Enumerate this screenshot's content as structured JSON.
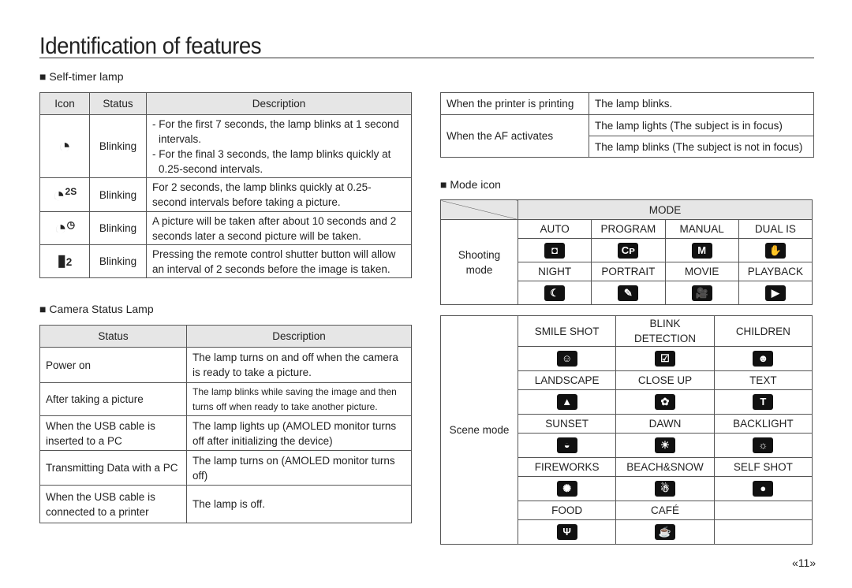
{
  "title": "Identification of features",
  "self_timer": {
    "heading": "■ Self-timer lamp",
    "headers": [
      "Icon",
      "Status",
      "Description"
    ],
    "rows": [
      {
        "icon": "self-timer-10s-icon",
        "status": "Blinking",
        "desc1": "- For the first 7 seconds, the lamp blinks at 1 second",
        "desc1b": "intervals.",
        "desc2": "- For the final 3 seconds, the lamp blinks quickly at",
        "desc2b": "0.25-second intervals."
      },
      {
        "icon": "self-timer-2s-icon",
        "icon_text": "2S",
        "status": "Blinking",
        "desc": "For 2 seconds, the lamp blinks quickly at 0.25-second intervals before taking a picture."
      },
      {
        "icon": "double-timer-icon",
        "status": "Blinking",
        "desc": "A picture will be taken after about 10 seconds and 2 seconds later a second picture will be taken."
      },
      {
        "icon": "remote-2s-icon",
        "icon_text": "2",
        "status": "Blinking",
        "desc": "Pressing the remote control shutter button will allow an interval of 2 seconds before the image is taken."
      }
    ]
  },
  "camera_status": {
    "heading": "■ Camera Status Lamp",
    "headers": [
      "Status",
      "Description"
    ],
    "rows": [
      {
        "status": "Power on",
        "desc": "The lamp turns on and off when the camera is ready to take a picture."
      },
      {
        "status": "After taking a picture",
        "desc": "The lamp blinks while saving the image and then turns off when ready to take another picture."
      },
      {
        "status": "When the USB cable is inserted to a PC",
        "desc": "The lamp lights up (AMOLED monitor turns off after initializing the device)"
      },
      {
        "status": "Transmitting Data with a PC",
        "desc": "The lamp turns on (AMOLED monitor turns off)"
      },
      {
        "status": "When the USB cable is connected to a printer",
        "desc": "The lamp is off."
      }
    ]
  },
  "printer": {
    "rows": [
      {
        "status": "When the printer is printing",
        "desc": "The lamp blinks."
      },
      {
        "status": "When the AF activates",
        "desc": "The lamp lights (The subject is in focus)",
        "desc2": "The lamp blinks (The subject is not in focus)"
      }
    ]
  },
  "mode_icon": {
    "heading": "■ Mode icon",
    "mode_header": "MODE",
    "shooting_label": "Shooting mode",
    "shooting": [
      {
        "label": "AUTO",
        "icon": "camera-icon",
        "glyph": "◘"
      },
      {
        "label": "PROGRAM",
        "icon": "program-icon",
        "glyph": "Cᴘ"
      },
      {
        "label": "MANUAL",
        "icon": "manual-icon",
        "glyph": "M"
      },
      {
        "label": "DUAL IS",
        "icon": "dual-is-icon",
        "glyph": "✋"
      },
      {
        "label": "NIGHT",
        "icon": "night-icon",
        "glyph": "☾"
      },
      {
        "label": "PORTRAIT",
        "icon": "portrait-icon",
        "glyph": "✎"
      },
      {
        "label": "MOVIE",
        "icon": "movie-icon",
        "glyph": "🎥"
      },
      {
        "label": "PLAYBACK",
        "icon": "playback-icon",
        "glyph": "▶"
      }
    ],
    "scene_label": "Scene mode",
    "scene": [
      {
        "label": "SMILE SHOT",
        "icon": "smile-icon",
        "glyph": "☺"
      },
      {
        "label": "BLINK DETECTION",
        "icon": "blink-detection-icon",
        "glyph": "☑"
      },
      {
        "label": "CHILDREN",
        "icon": "children-icon",
        "glyph": "☻"
      },
      {
        "label": "LANDSCAPE",
        "icon": "landscape-icon",
        "glyph": "▲"
      },
      {
        "label": "CLOSE UP",
        "icon": "close-up-icon",
        "glyph": "✿"
      },
      {
        "label": "TEXT",
        "icon": "text-icon",
        "glyph": "T"
      },
      {
        "label": "SUNSET",
        "icon": "sunset-icon",
        "glyph": "◒"
      },
      {
        "label": "DAWN",
        "icon": "dawn-icon",
        "glyph": "☀"
      },
      {
        "label": "BACKLIGHT",
        "icon": "backlight-icon",
        "glyph": "☼"
      },
      {
        "label": "FIREWORKS",
        "icon": "fireworks-icon",
        "glyph": "✺"
      },
      {
        "label": "BEACH&SNOW",
        "icon": "beach-snow-icon",
        "glyph": "☃"
      },
      {
        "label": "SELF SHOT",
        "icon": "self-shot-icon",
        "glyph": "●"
      },
      {
        "label": "FOOD",
        "icon": "food-icon",
        "glyph": "Ψ"
      },
      {
        "label": "CAFÉ",
        "icon": "cafe-icon",
        "glyph": "☕"
      }
    ]
  },
  "page_number": "«11»"
}
